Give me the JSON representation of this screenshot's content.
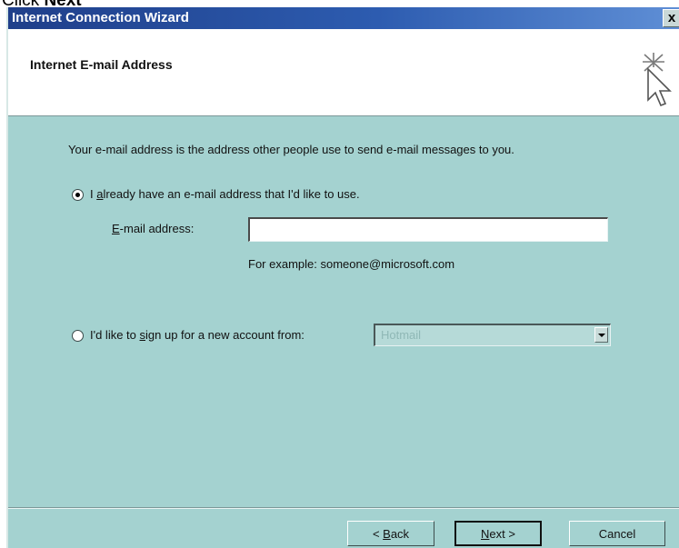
{
  "caption": {
    "prefix": "Click ",
    "bold": "Next"
  },
  "window": {
    "title": "Internet Connection Wizard",
    "close_label": "x"
  },
  "header": {
    "title": "Internet E-mail Address"
  },
  "body": {
    "intro": "Your e-mail address is the address other people use to send e-mail messages to you."
  },
  "option_existing": {
    "selected": true,
    "label_pre": "I ",
    "label_underlined": "a",
    "label_post": "lready have an e-mail address that I'd like to use."
  },
  "email_field": {
    "label_underlined": "E",
    "label_rest": "-mail address:",
    "value": "",
    "example": "For example: someone@microsoft.com"
  },
  "option_new": {
    "selected": false,
    "label_pre": "I'd like to ",
    "label_underlined": "s",
    "label_post": "ign up for a new account from:",
    "provider": "Hotmail",
    "provider_enabled": false
  },
  "buttons": {
    "back_pre": "< ",
    "back_underlined": "B",
    "back_post": "ack",
    "next_underlined": "N",
    "next_post": "ext >",
    "cancel": "Cancel"
  },
  "colors": {
    "dialog_background": "#a4d2d0",
    "title_bar": "#1f3f8a",
    "header_background": "#ffffff"
  },
  "icons": {
    "header_icon": "wizard-cursor-sparkle-icon",
    "close_icon": "close-icon",
    "dropdown_icon": "chevron-down-icon"
  }
}
